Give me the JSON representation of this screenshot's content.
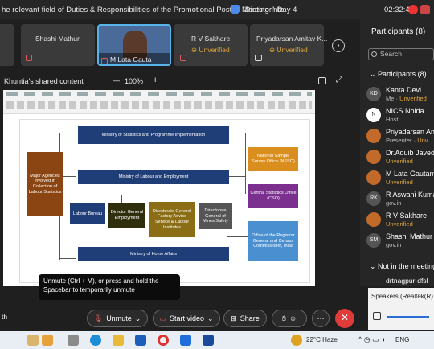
{
  "titlebar": {
    "title": "he relevant field of Duties & Responsibilities of the Promotional Post to \"Director\"-Day 4",
    "meeting_info": "Meeting Info",
    "clock": "02:32:46"
  },
  "video_strip": {
    "tiles": [
      {
        "name": "Shashi Mathur"
      },
      {
        "name": "M Lata Gauta"
      },
      {
        "name": "R V Sakhare",
        "status": "Unverified"
      },
      {
        "name": "Priyadarsan Amitav K...",
        "status": "Unverified"
      }
    ]
  },
  "share": {
    "label": "Khuntia's shared content",
    "zoom_minus": "—",
    "zoom": "100%",
    "zoom_plus": "+"
  },
  "slide": {
    "boxes": {
      "mospi": "Ministry of Statistics and Programme Implementation",
      "major": "Major Agencies involved in Collection of Labour Statistics",
      "labour": "Ministry of Labour and Employment",
      "bureau": "Labour Bureau",
      "dge": "Director General Employment",
      "dgfasli": "Directorate General Factory Advice Service & Labour Institutes",
      "dgms": "Directorate General of Mines Safety",
      "nsso": "National Sample Survey Office (NSSO)",
      "cso": "Central Statistics Office (CSO)",
      "rgi": "Office of the Registrar General and Census Commissioner, India",
      "home": "Ministry of Home Affairs"
    }
  },
  "participants": {
    "title": "Participants (8)",
    "search_placeholder": "Search",
    "section": "Participants (8)",
    "items": [
      {
        "initials": "KD",
        "name": "Kanta Devi",
        "sub": "Me · ",
        "status": "Unverified",
        "color": "#555555"
      },
      {
        "initials": "N",
        "name": "NICS Noida",
        "sub": "Host",
        "status": "",
        "color": "#ffffff"
      },
      {
        "initials": "",
        "name": "Priyadarsan An",
        "sub": "Presenter · ",
        "status": "Unv",
        "color": "#c26a2a"
      },
      {
        "initials": "",
        "name": "Dr.Aquib Javed",
        "sub": "",
        "status": "Unverified",
        "color": "#c26a2a"
      },
      {
        "initials": "",
        "name": "M Lata Gautam",
        "sub": "",
        "status": "Unverified",
        "color": "#c26a2a"
      },
      {
        "initials": "RK",
        "name": "R Aswani Kuma",
        "sub": "gov.in",
        "status": "",
        "color": "#555555"
      },
      {
        "initials": "",
        "name": "R V Sakhare",
        "sub": "",
        "status": "Unverified",
        "color": "#c26a2a"
      },
      {
        "initials": "SM",
        "name": "Shashi Mathur",
        "sub": "gov.in",
        "status": "",
        "color": "#555555"
      }
    ],
    "not_in_meeting": "Not in the meeting",
    "next_item": "drtnagpur-dfsl"
  },
  "tooltip": "Unmute (Ctrl + M), or press and hold the Spacebar to temporarily unmute",
  "speaker": {
    "label": "Speakers (Realtek(R)"
  },
  "controls": {
    "left_text": "th",
    "unmute": "Unmute",
    "video": "Start video",
    "share": "Share",
    "more": "···",
    "leave": "✕"
  },
  "taskbar": {
    "weather": "22°C  Haze",
    "lang": "ENG"
  }
}
